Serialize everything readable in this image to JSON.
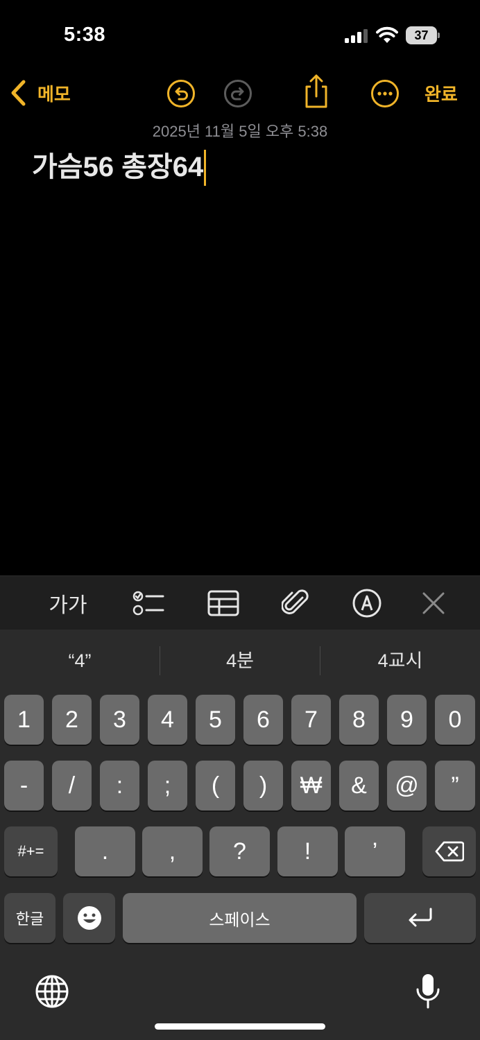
{
  "status_bar": {
    "time": "5:38",
    "battery": "37"
  },
  "nav": {
    "back_label": "메모",
    "done_label": "완료",
    "icons": [
      "chevron-left-icon",
      "undo-icon",
      "redo-icon",
      "share-icon",
      "more-icon"
    ],
    "accent_color": "#f0b429"
  },
  "note": {
    "date": "2025년 11월 5일 오후 5:38",
    "title": "가슴56 총장64"
  },
  "format_toolbar": {
    "text_format_label": "가가",
    "icons": [
      "checklist-icon",
      "table-icon",
      "paperclip-icon",
      "markup-icon",
      "close-icon"
    ]
  },
  "keyboard": {
    "suggestions": [
      "“4”",
      "4분",
      "4교시"
    ],
    "row1": [
      "1",
      "2",
      "3",
      "4",
      "5",
      "6",
      "7",
      "8",
      "9",
      "0"
    ],
    "row2": [
      "-",
      "/",
      ":",
      ";",
      "(",
      ")",
      "₩",
      "&",
      "@",
      "”"
    ],
    "row3": [
      ".",
      ",",
      "?",
      "!",
      "’"
    ],
    "symbols_label": "#+=",
    "language_label": "한글",
    "space_label": "스페이스",
    "icons": [
      "delete-icon",
      "emoji-icon",
      "return-icon",
      "globe-icon",
      "microphone-icon"
    ]
  }
}
